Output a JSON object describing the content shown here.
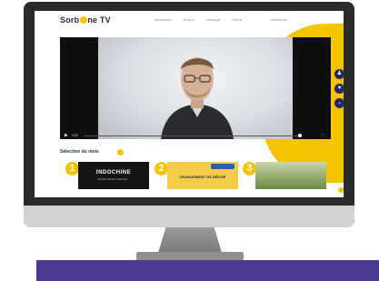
{
  "site": {
    "logo_text_before": "Sorb",
    "logo_text_after": "ne TV"
  },
  "nav": {
    "links": [
      "Nouveautés",
      "Droits ▾",
      "Catalogue",
      "Directs"
    ],
    "search": "Rechercher"
  },
  "video": {
    "time": "0:00",
    "side_buttons": [
      "♟",
      "♥",
      "⌄"
    ]
  },
  "section": {
    "title": "Sélection du mois"
  },
  "cards": [
    {
      "number": "1",
      "title": "INDOCHINE",
      "subtitle": "DE RETOUR AU CHANTIER ... "
    },
    {
      "number": "2",
      "title": "CHANGEMENT DE DÉCOR",
      "subtitle": ""
    },
    {
      "number": "3",
      "title": ""
    }
  ],
  "colors": {
    "accent_yellow": "#f5c400",
    "brand_navy": "#1f2a6b",
    "floor_purple": "#4e3b91"
  }
}
